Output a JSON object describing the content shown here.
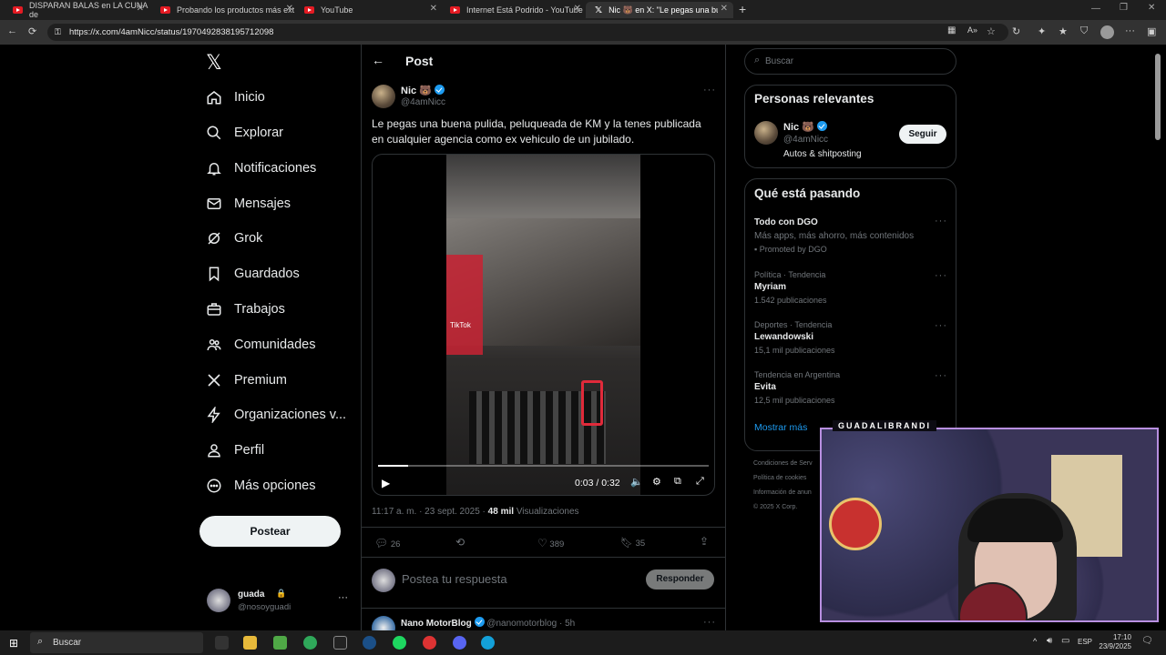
{
  "browser": {
    "tabs": [
      {
        "title": "DISPARAN BALAS en LA CUNA de",
        "icon": "youtube-icon"
      },
      {
        "title": "Probando los productos más ext",
        "icon": "youtube-icon"
      },
      {
        "title": "YouTube",
        "icon": "youtube-icon"
      },
      {
        "title": "Internet Está Podrido - YouTube",
        "icon": "youtube-icon"
      },
      {
        "title": "Nic 🐻 en X: \"Le pegas una buen",
        "icon": "x-icon"
      }
    ],
    "url": "https://x.com/4amNicc/status/1970492838195712098"
  },
  "nav": {
    "logo": "𝕏",
    "items": [
      {
        "label": "Inicio",
        "icon": "home-icon"
      },
      {
        "label": "Explorar",
        "icon": "search-icon"
      },
      {
        "label": "Notificaciones",
        "icon": "bell-icon"
      },
      {
        "label": "Mensajes",
        "icon": "mail-icon"
      },
      {
        "label": "Grok",
        "icon": "grok-icon"
      },
      {
        "label": "Guardados",
        "icon": "bookmark-icon"
      },
      {
        "label": "Trabajos",
        "icon": "briefcase-icon"
      },
      {
        "label": "Comunidades",
        "icon": "people-icon"
      },
      {
        "label": "Premium",
        "icon": "x-icon"
      },
      {
        "label": "Organizaciones v...",
        "icon": "lightning-icon"
      },
      {
        "label": "Perfil",
        "icon": "person-icon"
      },
      {
        "label": "Más opciones",
        "icon": "more-circle-icon"
      }
    ],
    "post_button": "Postear",
    "account": {
      "name": "guada",
      "handle": "@nosoyguadi"
    }
  },
  "post": {
    "header_title": "Post",
    "author": "Nic 🐻",
    "handle": "@4amNicc",
    "text": "Le pegas una buena pulida, peluqueada de KM y la tenes publicada en cualquier agencia como ex vehiculo de un jubilado.",
    "video_time": "0:03 / 0:32",
    "video_watermark": "TikTok",
    "video_progress": 0.09,
    "meta_time": "11:17 a. m. · 23 sept. 2025 ·",
    "views_count": "48 mil",
    "views_label": "Visualizaciones",
    "replies": "26",
    "likes": "389",
    "bookmarks": "35",
    "reply_placeholder": "Postea tu respuesta",
    "reply_button": "Responder",
    "next_author": "Nano MotorBlog",
    "next_handle": "@nanomotorblog · 5h"
  },
  "sidebar": {
    "search_placeholder": "Buscar",
    "relevant_title": "Personas relevantes",
    "relevant_name": "Nic 🐻",
    "relevant_handle": "@4amNicc",
    "relevant_bio": "Autos & shitposting",
    "follow_button": "Seguir",
    "trends_title": "Qué está pasando",
    "trends": [
      {
        "category": "",
        "name": "Todo con DGO",
        "sub": "Más apps, más ahorro, más contenidos",
        "count": "Promoted by DGO"
      },
      {
        "category": "Política · Tendencia",
        "name": "Myriam",
        "sub": "",
        "count": "1.542 publicaciones"
      },
      {
        "category": "Deportes · Tendencia",
        "name": "Lewandowski",
        "sub": "",
        "count": "15,1 mil publicaciones"
      },
      {
        "category": "Tendencia en Argentina",
        "name": "Evita",
        "sub": "",
        "count": "12,5 mil publicaciones"
      }
    ],
    "show_more": "Mostrar más",
    "footer": [
      "Condiciones de Serv",
      "Política de cookies",
      "Información de anun",
      "© 2025 X Corp."
    ]
  },
  "webcam": {
    "label": "GUADALIBRANDI"
  },
  "taskbar": {
    "search": "Buscar",
    "lang": "ESP",
    "time": "17:10",
    "date": "23/9/2025"
  },
  "colors": {
    "accent": "#1d9bf0",
    "background": "#000000",
    "text": "#e7e9ea",
    "muted": "#71767b"
  }
}
